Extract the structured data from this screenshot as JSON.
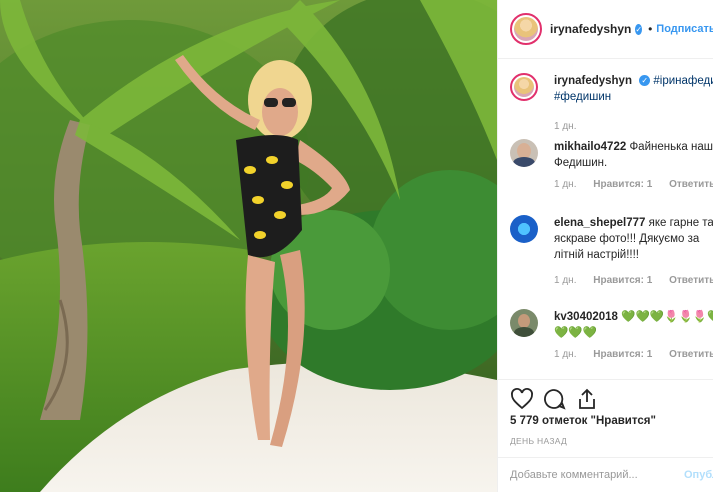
{
  "header": {
    "username": "irynafedyshyn",
    "follow_label": "Подписаться",
    "dot": "•",
    "verified": "✓"
  },
  "caption": {
    "username": "irynafedyshyn",
    "hashtag1": "#іринафедишин",
    "hashtag2": "#федишин",
    "time": "1 дн."
  },
  "comments": [
    {
      "username": "mikhailo4722",
      "line1": "Файненька наша",
      "line2": "Федишин.",
      "time": "1 дн.",
      "likes": "Нравится: 1",
      "reply": "Ответить"
    },
    {
      "username": "elena_shepel777",
      "line1": "яке гарне та",
      "line2": "яскраве фото!!! Дякуємо за",
      "line3": "літній настрій!!!!",
      "time": "1 дн.",
      "likes": "Нравится: 1",
      "reply": "Ответить"
    },
    {
      "username": "kv30402018",
      "line1": "💚💚💚🌷🌷🌷💚",
      "line2": "💚💚💚",
      "time": "1 дн.",
      "likes": "Нравится: 1",
      "reply": "Ответить"
    }
  ],
  "likes_text": "5 779 отметок \"Нравится\"",
  "timestamp": "ДЕНЬ НАЗАД",
  "add_comment": {
    "placeholder": "Добавьте комментарий...",
    "post_label": "Опубликовать"
  },
  "colors": {
    "link": "#3897f0",
    "text": "#262626",
    "muted": "#999999"
  }
}
